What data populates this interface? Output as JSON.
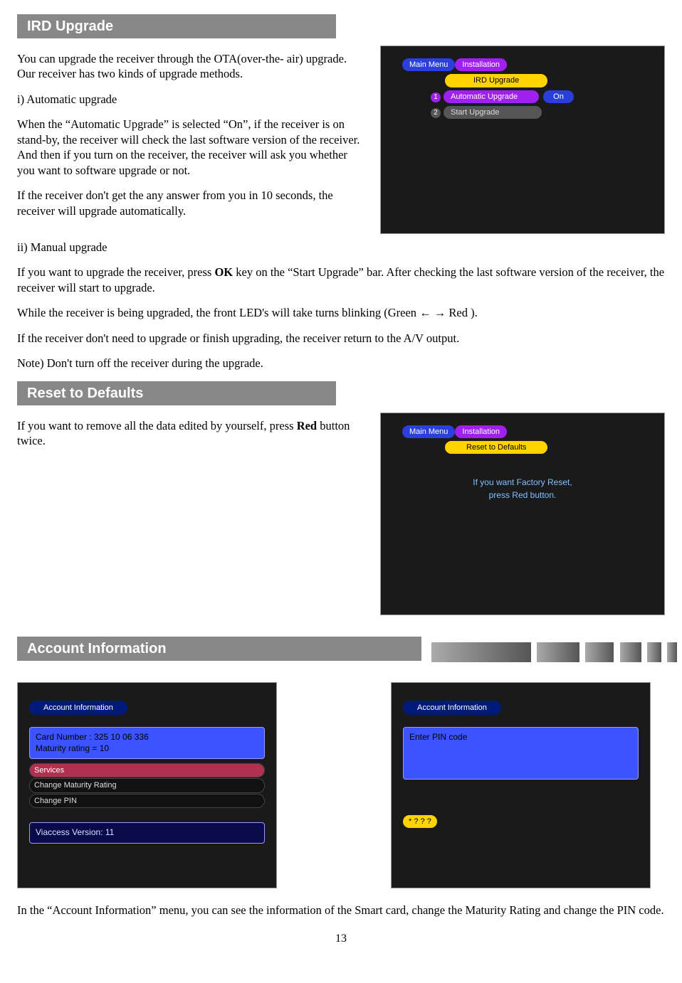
{
  "irdUpgrade": {
    "header": "IRD Upgrade",
    "p1": "You can upgrade the receiver through the OTA(over-the- air) upgrade. Our receiver has two kinds of upgrade methods.",
    "p2": "i) Automatic upgrade",
    "p3": "When the “Automatic Upgrade” is selected “On”, if the receiver is on stand-by, the receiver will check the last software  version of the receiver. And then if you turn on the receiver, the receiver will ask you whether you want to software upgrade or not.",
    "p4": "If the receiver don't get the any answer from you in 10 seconds, the receiver will upgrade automatically.",
    "p5": "ii) Manual upgrade",
    "p6_pre": "If you want to upgrade the receiver, press ",
    "p6_key": "OK",
    "p6_post": " key on the “Start Upgrade” bar. After checking the last software version of the receiver, the receiver will start to upgrade.",
    "p7": "While the receiver is being upgraded, the front LED's will take turns blinking (Green ← → Red ).",
    "p8": "If the receiver don't need to upgrade or finish upgrading, the receiver return to the A/V output.",
    "p9": "Note) Don't turn off the receiver during the upgrade.",
    "screen": {
      "breadcrumb1": "Main Menu",
      "breadcrumb2": "Installation",
      "title": "IRD Upgrade",
      "item1": "Automatic Upgrade",
      "item1value": "On",
      "item2": "Start Upgrade"
    }
  },
  "resetDefaults": {
    "header": "Reset to Defaults",
    "p1_pre": "If you want to remove all the data edited by yourself, press ",
    "p1_key": "Red",
    "p1_post": " button twice.",
    "screen": {
      "breadcrumb1": "Main Menu",
      "breadcrumb2": "Installation",
      "title": "Reset to Defaults",
      "msg1": "If you want Factory Reset,",
      "msg2": "press Red button."
    }
  },
  "accountInfo": {
    "header": "Account Information",
    "p1": "In the “Account Information” menu, you can see the information of the Smart card, change the Maturity Rating and change the PIN code.",
    "screenA": {
      "title": "Account Information",
      "card": "Card Number : 325 10 06 336",
      "maturity": "Maturity rating = 10",
      "services": "Services",
      "changeMaturity": "Change Maturity Rating",
      "changePin": "Change PIN",
      "version": "Viaccess Version:  11"
    },
    "screenB": {
      "title": "Account Information",
      "enterPin": "Enter PIN code",
      "stars": "* ? ? ?"
    }
  },
  "pageNumber": "13"
}
